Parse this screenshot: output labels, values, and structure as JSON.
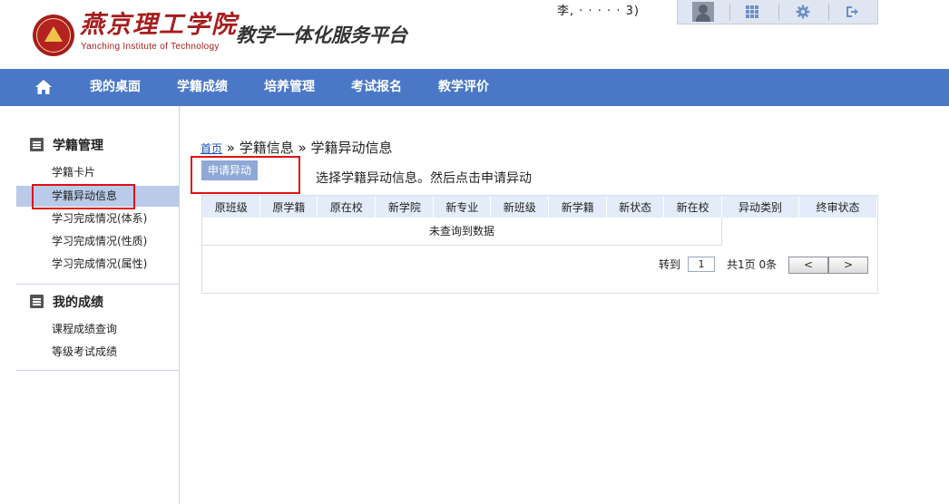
{
  "header": {
    "logo_cn": "燕京理工学院",
    "logo_en": "Yanching Institute of Technology",
    "platform_title": "教学一体化服务平台",
    "user_name": "李,           · · · · ·  3)"
  },
  "nav": {
    "items": [
      {
        "label": "我的桌面"
      },
      {
        "label": "学籍成绩"
      },
      {
        "label": "培养管理"
      },
      {
        "label": "考试报名"
      },
      {
        "label": "教学评价"
      }
    ]
  },
  "sidebar": {
    "groups": [
      {
        "title": "学籍管理",
        "items": [
          {
            "label": "学籍卡片"
          },
          {
            "label": "学籍异动信息"
          },
          {
            "label": "学习完成情况(体系)"
          },
          {
            "label": "学习完成情况(性质)"
          },
          {
            "label": "学习完成情况(属性)"
          }
        ]
      },
      {
        "title": "我的成绩",
        "items": [
          {
            "label": "课程成绩查询"
          },
          {
            "label": "等级考试成绩"
          }
        ]
      }
    ]
  },
  "main": {
    "breadcrumb": {
      "home": "首页",
      "separator": "»",
      "level1": "学籍信息",
      "level2": "学籍异动信息"
    },
    "apply_button": "申请异动",
    "hint": "选择学籍异动信息。然后点击申请异动",
    "table": {
      "columns": [
        "原班级",
        "原学籍",
        "原在校",
        "新学院",
        "新专业",
        "新班级",
        "新学籍",
        "新状态",
        "新在校",
        "异动类别",
        "终审状态"
      ],
      "empty_text": "未查询到数据"
    },
    "pager": {
      "goto_label": "转到",
      "page_value": "1",
      "summary": "共1页 0条",
      "prev": "<",
      "next": ">"
    }
  },
  "colors": {
    "nav_bg": "#4a78c6",
    "brand_red": "#a61d1d",
    "active_item_bg": "#b9cbe8",
    "highlight_box": "#e01010",
    "table_header_bg": "#e3ecf8"
  }
}
